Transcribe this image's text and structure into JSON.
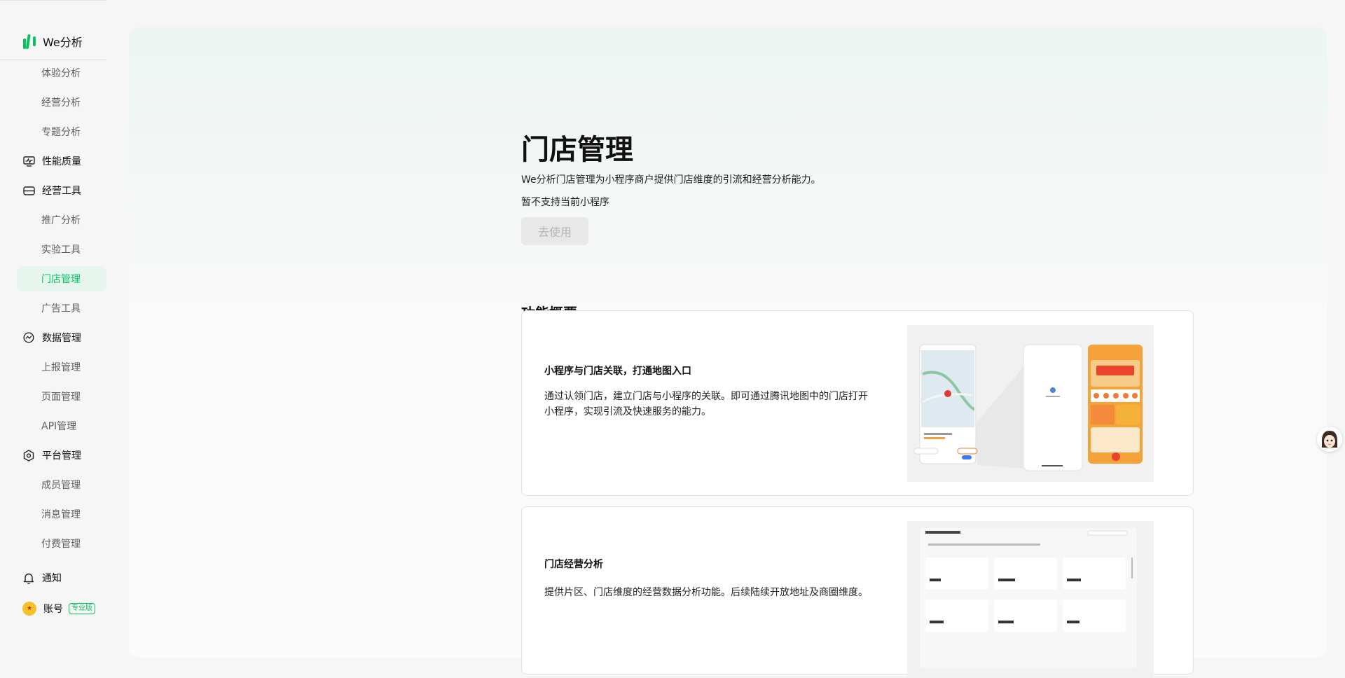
{
  "app": {
    "name": "We分析"
  },
  "sidebar": {
    "items": [
      {
        "label": "体验分析",
        "kind": "sub"
      },
      {
        "label": "经营分析",
        "kind": "sub"
      },
      {
        "label": "专题分析",
        "kind": "sub"
      },
      {
        "label": "性能质量",
        "kind": "group",
        "icon": "monitor-icon"
      },
      {
        "label": "经营工具",
        "kind": "group",
        "icon": "toolbox-icon"
      },
      {
        "label": "推广分析",
        "kind": "sub"
      },
      {
        "label": "实验工具",
        "kind": "sub"
      },
      {
        "label": "门店管理",
        "kind": "sub",
        "active": true
      },
      {
        "label": "广告工具",
        "kind": "sub"
      },
      {
        "label": "数据管理",
        "kind": "group",
        "icon": "data-icon"
      },
      {
        "label": "上报管理",
        "kind": "sub"
      },
      {
        "label": "页面管理",
        "kind": "sub"
      },
      {
        "label": "API管理",
        "kind": "sub"
      },
      {
        "label": "平台管理",
        "kind": "group",
        "icon": "hexagon-gear-icon"
      },
      {
        "label": "成员管理",
        "kind": "sub"
      },
      {
        "label": "消息管理",
        "kind": "sub"
      },
      {
        "label": "付费管理",
        "kind": "sub"
      }
    ],
    "notify_label": "通知",
    "account_label": "账号",
    "account_badge": "专业版"
  },
  "page": {
    "title": "门店管理",
    "description": "We分析门店管理为小程序商户提供门店维度的引流和经营分析能力。",
    "unsupported_text": "暂不支持当前小程序",
    "go_button": "去使用"
  },
  "overview": {
    "title": "功能概要",
    "cards": [
      {
        "title": "小程序与门店关联，打通地图入口",
        "desc": "通过认领门店，建立门店与小程序的关联。即可通过腾讯地图中的门店打开小程序，实现引流及快速服务的能力。"
      },
      {
        "title": "门店经营分析",
        "desc": "提供片区、门店维度的经营数据分析功能。后续陆续开放地址及商圈维度。"
      }
    ]
  },
  "colors": {
    "accent": "#07c160",
    "active_bg": "#e6f6ee",
    "text_secondary": "#5f5f5f"
  }
}
